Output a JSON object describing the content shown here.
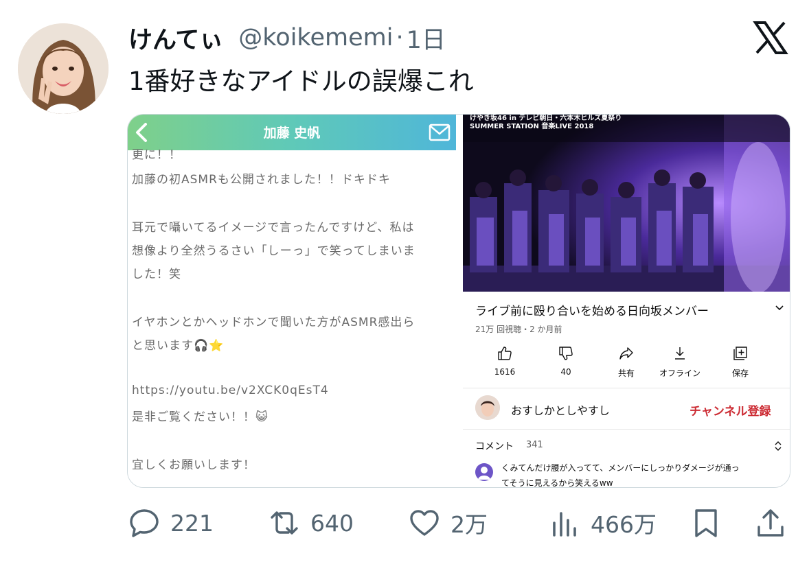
{
  "author": {
    "display_name": "けんてぃ",
    "handle": "@koikememi",
    "separator": "·",
    "time": "1日",
    "avatar_icon": "profile-photo"
  },
  "tweet_text": "1番好きなアイドルの誤爆これ",
  "platform_icon": "x-logo-icon",
  "blog": {
    "title": "加藤 史帆",
    "lines": [
      "更に！！",
      "加藤の初ASMRも公開されました！！ドキドキ",
      "耳元で囁いてるイメージで言ったんですけど、私は",
      "想像より全然うるさい「しーっ」で笑ってしまいま",
      "した！笑",
      "イヤホンとかヘッドホンで聞いた方がASMR感出ら",
      "と思います🎧⭐",
      "https://youtu.be/v2XCK0qEsT4",
      "是非ご覧ください！！😺",
      "宜しくお願いします！"
    ]
  },
  "youtube": {
    "video_caption_1": "けやき坂46 in テレビ朝日・六本木ヒルズ夏祭り",
    "video_caption_2": "SUMMER STATION 音楽LIVE 2018",
    "video_title": "ライブ前に殴り合いを始める日向坂メンバー",
    "meta": "21万 回視聴・2 か月前",
    "actions": [
      {
        "icon": "thumbs-up-icon",
        "label": "1616"
      },
      {
        "icon": "thumbs-down-icon",
        "label": "40"
      },
      {
        "icon": "share-icon",
        "label": "共有"
      },
      {
        "icon": "download-icon",
        "label": "オフライン"
      },
      {
        "icon": "save-playlist-icon",
        "label": "保存"
      }
    ],
    "channel_name": "おすしかとしやすし",
    "subscribe_label": "チャンネル登録",
    "comments_label": "コメント",
    "comments_count": "341",
    "comment_line_1": "くみてんだけ腰が入ってて、メンバーにしっかりダメージが通っ",
    "comment_line_2": "てそうに見えるから笑えるww",
    "subscribe_color": "#cc2b33"
  },
  "metrics": {
    "replies": "221",
    "retweets": "640",
    "likes": "2万",
    "views": "466万"
  },
  "colors": {
    "text_primary": "#0f1419",
    "text_secondary": "#536471",
    "blog_bar_gradient": [
      "#7fd08a",
      "#4fb6d9"
    ]
  }
}
